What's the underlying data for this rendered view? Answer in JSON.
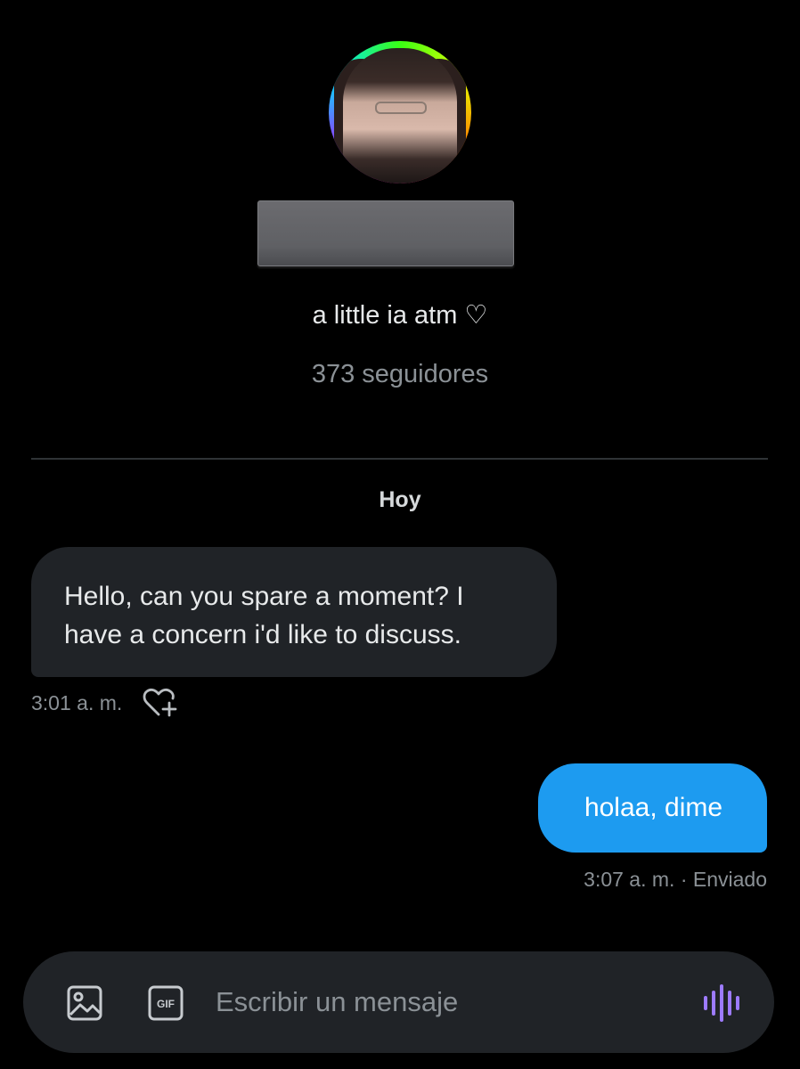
{
  "profile": {
    "bio": "a little ia atm ♡",
    "followers": "373 seguidores"
  },
  "conversation": {
    "day_label": "Hoy",
    "messages": [
      {
        "direction": "incoming",
        "text": "Hello, can you spare a moment? I have a concern i'd like to discuss.",
        "time": "3:01 a. m."
      },
      {
        "direction": "outgoing",
        "text": "holaa, dime",
        "time_status": "3:07 a. m. · Enviado"
      }
    ]
  },
  "composer": {
    "placeholder": "Escribir un mensaje",
    "gif_label": "GIF"
  },
  "colors": {
    "background": "#000000",
    "incoming_bubble": "#202327",
    "outgoing_bubble": "#1d9bf0",
    "muted_text": "#8b9196",
    "voice_accent": "#9d7bff"
  },
  "icons": [
    "image-icon",
    "gif-icon",
    "voice-message-icon",
    "add-reaction-icon"
  ]
}
